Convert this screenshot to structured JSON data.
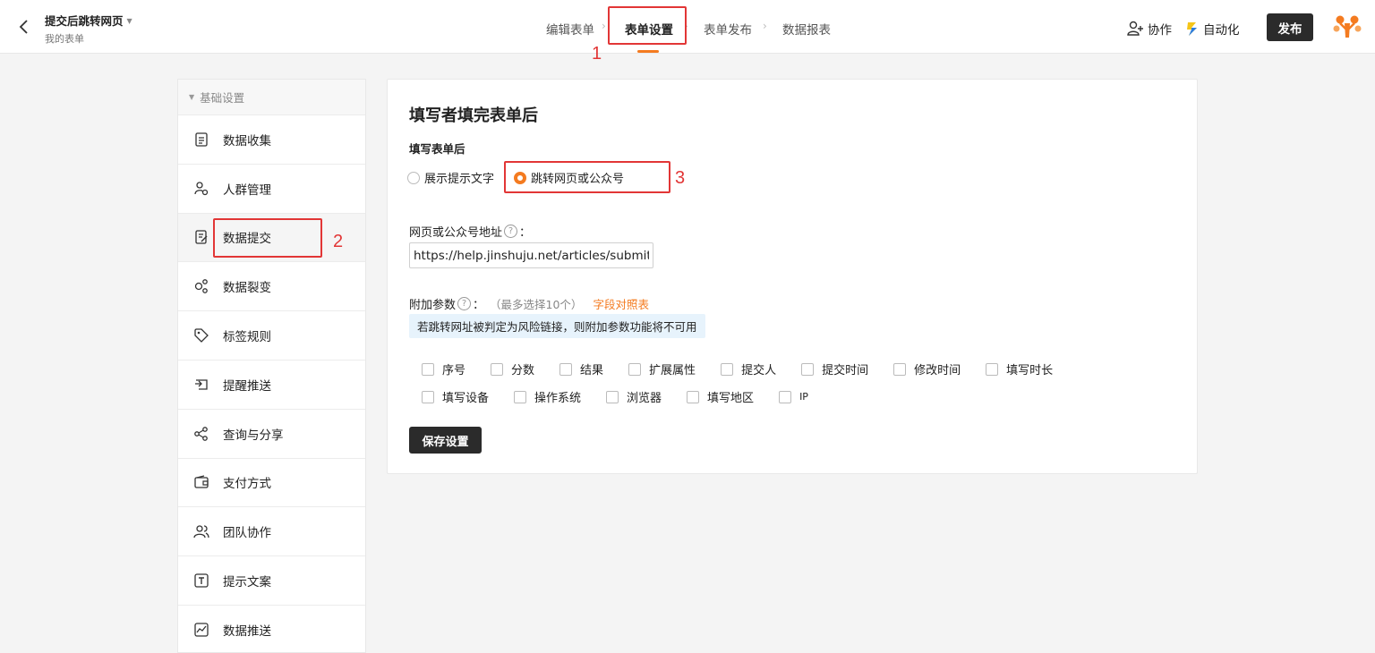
{
  "header": {
    "form_title": "提交后跳转网页",
    "form_sub": "我的表单",
    "steps": [
      {
        "label": "编辑表单"
      },
      {
        "label": "表单设置"
      },
      {
        "label": "表单发布"
      },
      {
        "label": "数据报表"
      }
    ],
    "active_step": 1,
    "collab_label": "协作",
    "automation_label": "自动化",
    "publish_label": "发布"
  },
  "sidebar": {
    "group_label": "基础设置",
    "items": [
      {
        "label": "数据收集",
        "icon": "document-icon"
      },
      {
        "label": "人群管理",
        "icon": "user-settings-icon"
      },
      {
        "label": "数据提交",
        "icon": "document-edit-icon"
      },
      {
        "label": "数据裂变",
        "icon": "fission-icon"
      },
      {
        "label": "标签规则",
        "icon": "tag-icon"
      },
      {
        "label": "提醒推送",
        "icon": "send-icon"
      },
      {
        "label": "查询与分享",
        "icon": "share-icon"
      },
      {
        "label": "支付方式",
        "icon": "wallet-icon"
      },
      {
        "label": "团队协作",
        "icon": "team-icon"
      },
      {
        "label": "提示文案",
        "icon": "text-icon"
      },
      {
        "label": "数据推送",
        "icon": "chart-icon"
      }
    ],
    "active_index": 2
  },
  "main": {
    "title": "填写者填完表单后",
    "section_label": "填写表单后",
    "radio_options": [
      "展示提示文字",
      "跳转网页或公众号"
    ],
    "selected_radio": 1,
    "url_label": "网页或公众号地址",
    "url_colon": "：",
    "url_value": "https://help.jinshuju.net/articles/submit-r",
    "params_label": "附加参数",
    "params_colon": "：",
    "params_hint": "（最多选择10个）",
    "params_link": "字段对照表",
    "notice": "若跳转网址被判定为风险链接，则附加参数功能将不可用",
    "checkboxes_row1": [
      "序号",
      "分数",
      "结果",
      "扩展属性",
      "提交人",
      "提交时间",
      "修改时间",
      "填写时长"
    ],
    "checkboxes_row2": [
      "填写设备",
      "操作系统",
      "浏览器",
      "填写地区",
      "IP"
    ],
    "save_label": "保存设置"
  },
  "annotations": [
    "1",
    "2",
    "3"
  ],
  "colors": {
    "accent": "#f47b20",
    "dark_button": "#2b2b2b",
    "annotation_red": "#e23636",
    "notice_bg": "#e7f3fc"
  }
}
